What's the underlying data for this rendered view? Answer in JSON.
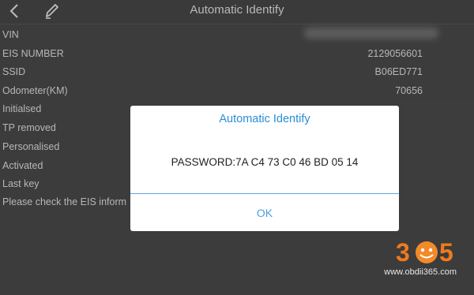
{
  "header": {
    "title": "Automatic Identify",
    "back_icon": "chevron-left-icon",
    "edit_icon": "pencil-icon"
  },
  "info_rows": [
    {
      "label": "VIN",
      "value": ""
    },
    {
      "label": "EIS NUMBER",
      "value": "2129056601"
    },
    {
      "label": "SSID",
      "value": "B06ED771"
    },
    {
      "label": "Odometer(KM)",
      "value": "70656"
    },
    {
      "label": "Initialsed",
      "value": ""
    },
    {
      "label": "TP removed",
      "value": ""
    },
    {
      "label": "Personalised",
      "value": ""
    },
    {
      "label": "Activated",
      "value": ""
    },
    {
      "label": "Last key",
      "value": ""
    },
    {
      "label": "Please check the EIS inform",
      "value": ""
    }
  ],
  "dialog": {
    "title": "Automatic Identify",
    "message": "PASSWORD:7A C4 73 C0 46 BD 05 14",
    "ok_label": "OK"
  },
  "watermark": {
    "logo_text": "365",
    "url": "www.obdii365.com"
  },
  "colors": {
    "accent": "#2b8ed6",
    "background": "#454545",
    "dialog_bg": "#ffffff"
  }
}
